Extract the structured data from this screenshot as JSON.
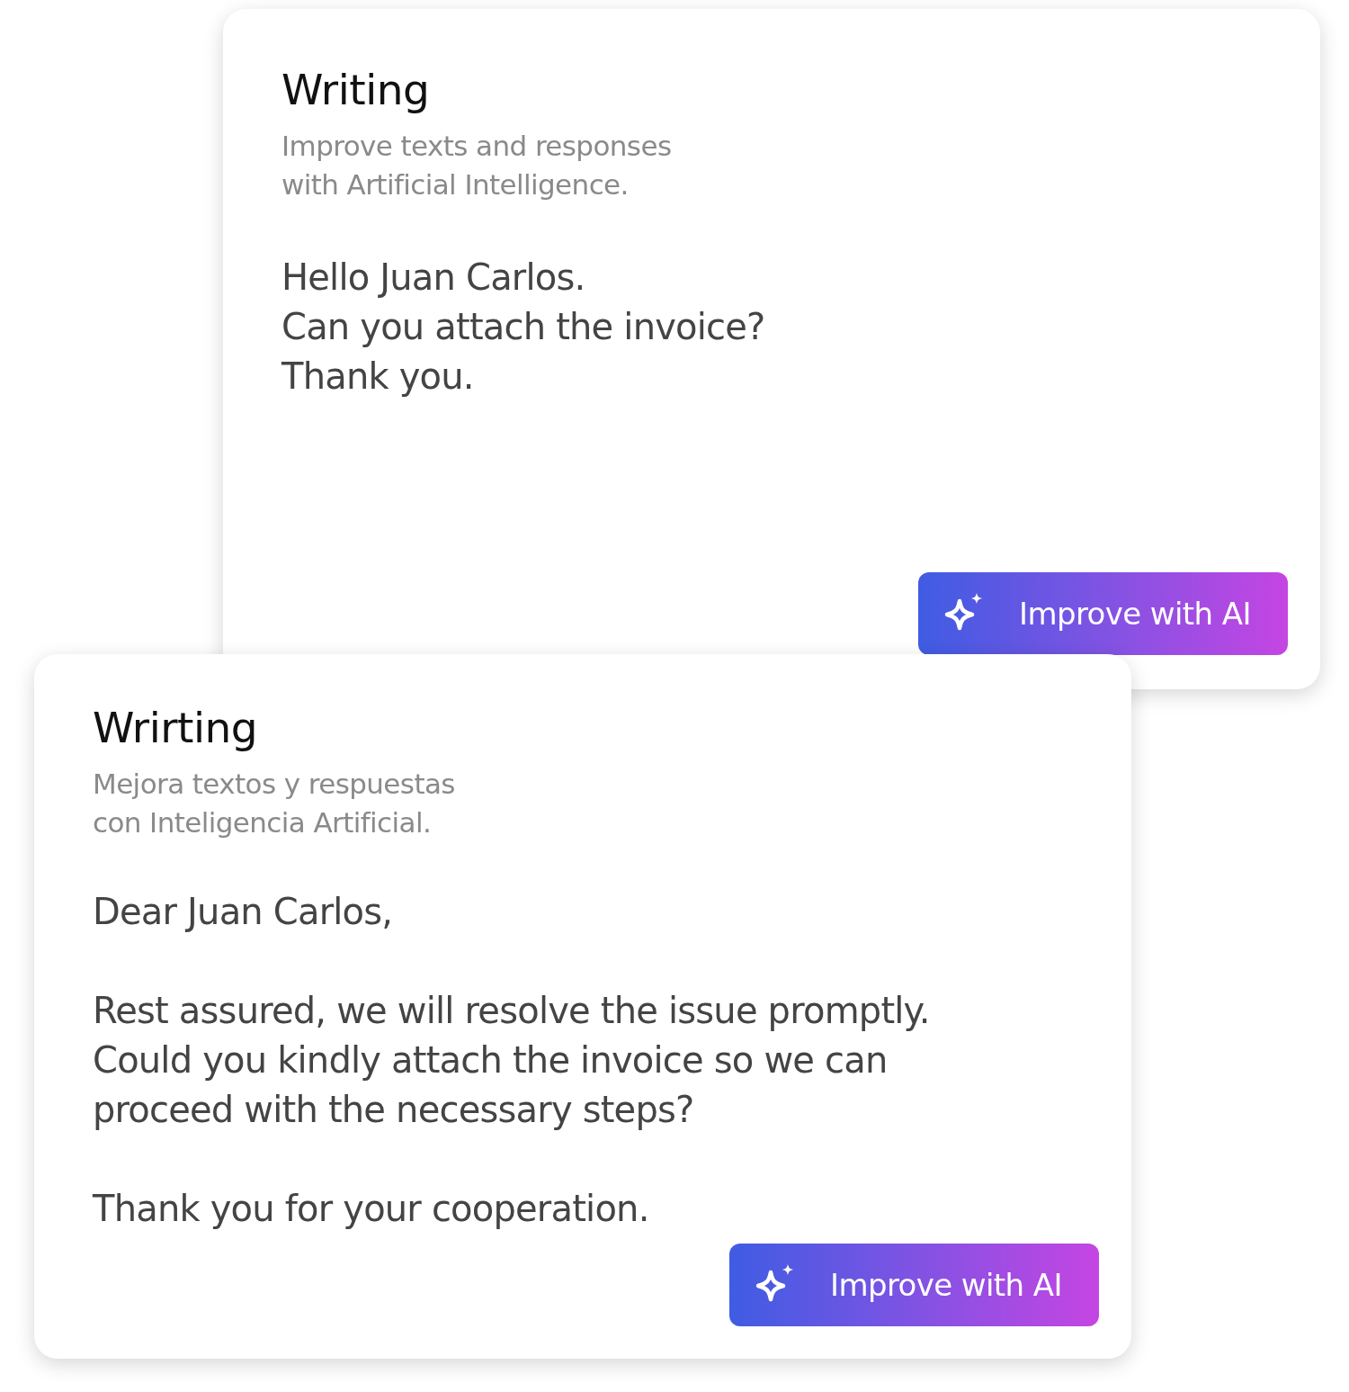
{
  "cards": [
    {
      "title": "Writing",
      "subtitle_lines": [
        "Improve texts and responses",
        "with Artificial Intelligence."
      ],
      "paragraphs": [
        {
          "lines": [
            "Hello Juan Carlos.",
            "Can you attach the invoice?",
            "Thank you."
          ]
        }
      ],
      "button": "Improve with AI"
    },
    {
      "title": "Wrirting",
      "subtitle_lines": [
        "Mejora textos y respuestas",
        "con Inteligencia Artificial."
      ],
      "paragraphs": [
        {
          "lines": [
            "Dear Juan Carlos,"
          ]
        },
        {
          "lines": [
            "Rest assured, we will resolve the issue promptly.",
            "Could you kindly attach the invoice so we can",
            "proceed with the necessary steps?"
          ]
        },
        {
          "lines": [
            "Thank you for your cooperation."
          ]
        }
      ],
      "button": "Improve with AI"
    }
  ]
}
